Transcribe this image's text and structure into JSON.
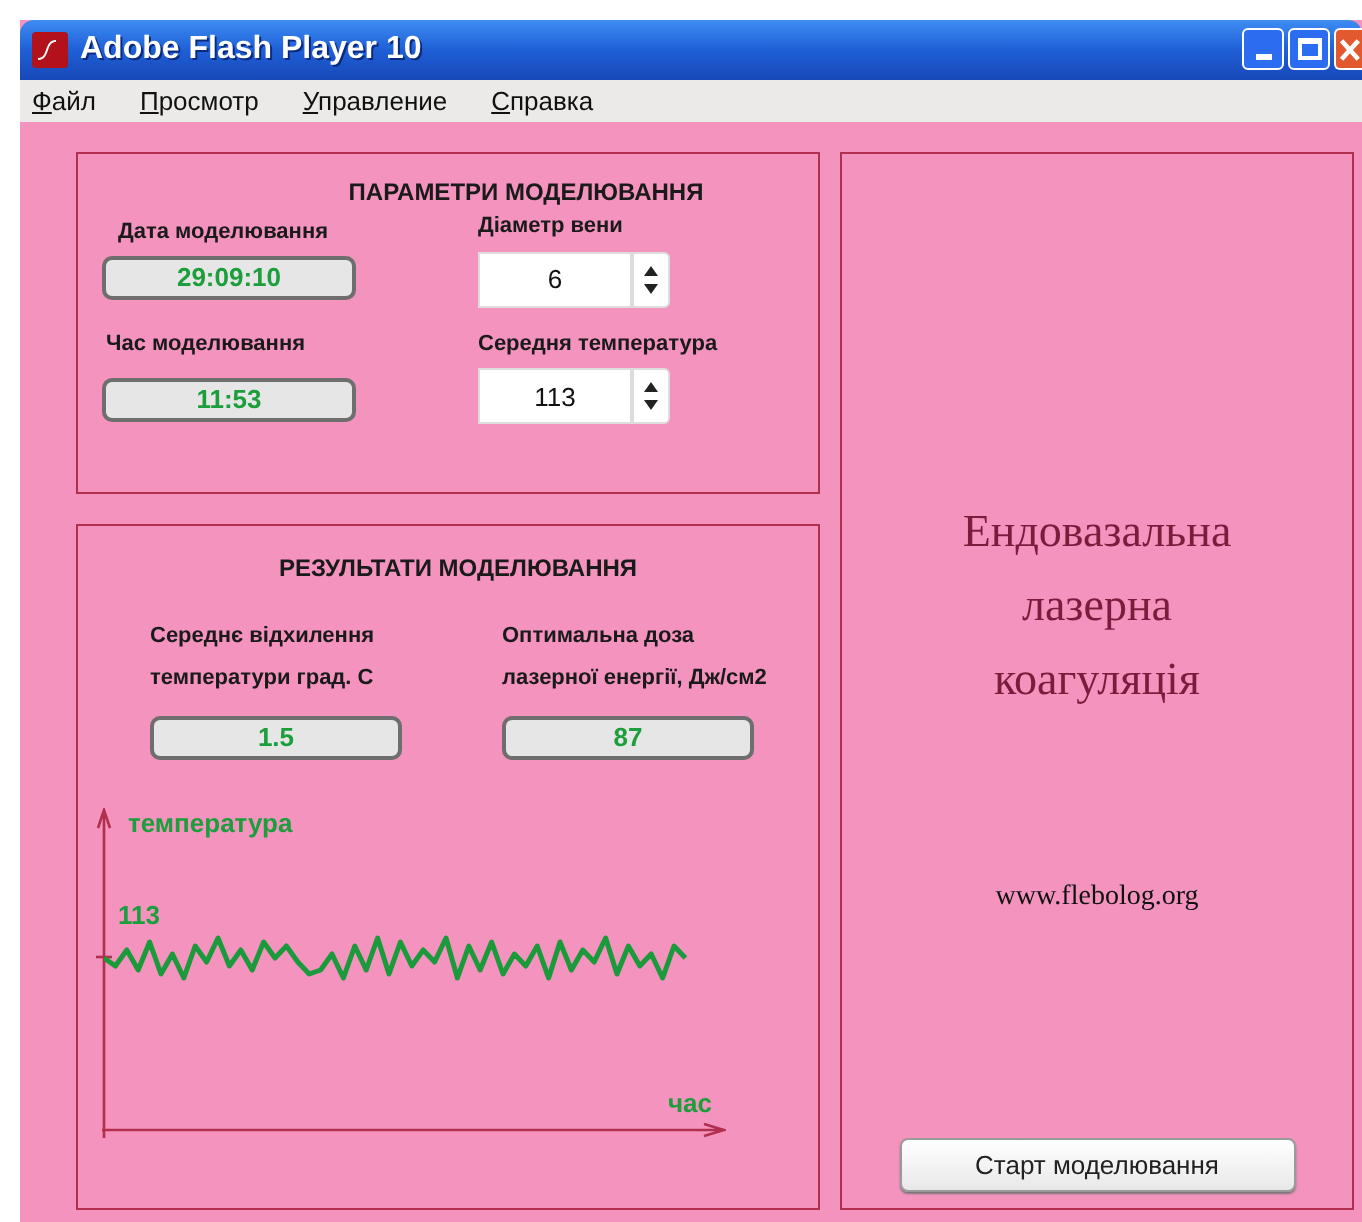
{
  "window": {
    "title": "Adobe Flash Player 10"
  },
  "menu": [
    {
      "mnemonic": "Ф",
      "rest": "айл"
    },
    {
      "mnemonic": "П",
      "rest": "росмотр"
    },
    {
      "mnemonic": "У",
      "rest": "правление"
    },
    {
      "mnemonic": "С",
      "rest": "правка"
    }
  ],
  "parameters": {
    "title": "ПАРАМЕТРИ МОДЕЛЮВАННЯ",
    "displays": [
      {
        "label": "Дата моделювання",
        "value": "29:09:10"
      },
      {
        "label": "Час моделювання",
        "value": "11:53"
      }
    ],
    "spinners": [
      {
        "label": "Діаметр вени",
        "value": "6"
      },
      {
        "label": "Середня температура",
        "value": "113"
      }
    ]
  },
  "results": {
    "title": "РЕЗУЛЬТАТИ МОДЕЛЮВАННЯ",
    "displays": [
      {
        "label_lines": [
          "Середнє відхилення",
          "температури град. С"
        ],
        "value": "1.5"
      },
      {
        "label_lines": [
          "Оптимальна доза",
          "лазерної енергії, Дж/см2"
        ],
        "value": "87"
      }
    ],
    "graph": {
      "y_label": "температура",
      "level_label": "113",
      "x_label": "час"
    }
  },
  "info": {
    "heading": "Ендовазальна лазерна коагуляція",
    "website": "www.flebolog.org",
    "start_button": "Старт моделювання"
  }
}
